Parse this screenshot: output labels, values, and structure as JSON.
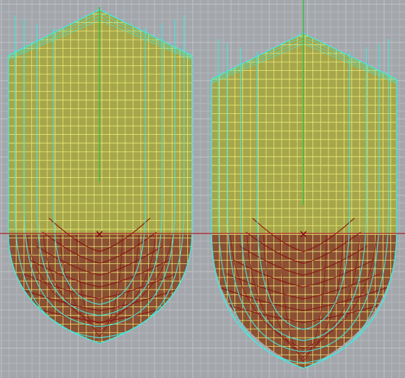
{
  "viewport": {
    "view": "body plan",
    "grid": true,
    "colors": {
      "background": "#a3a7ab",
      "grid_minor": "#b5b8bc",
      "grid_major": "#c2c5c8",
      "hull_above": "#a6a642",
      "hull_below": "#8a4a2c",
      "mesh": "#f0f07a",
      "section_cyan": "#46e6dc",
      "waterline_red": "#8b0f12",
      "datum_line": "#b01c28",
      "centerline_green": "#39c040"
    }
  },
  "hulls": [
    {
      "id": "hull-left",
      "label": ""
    },
    {
      "id": "hull-right",
      "label": ""
    }
  ]
}
